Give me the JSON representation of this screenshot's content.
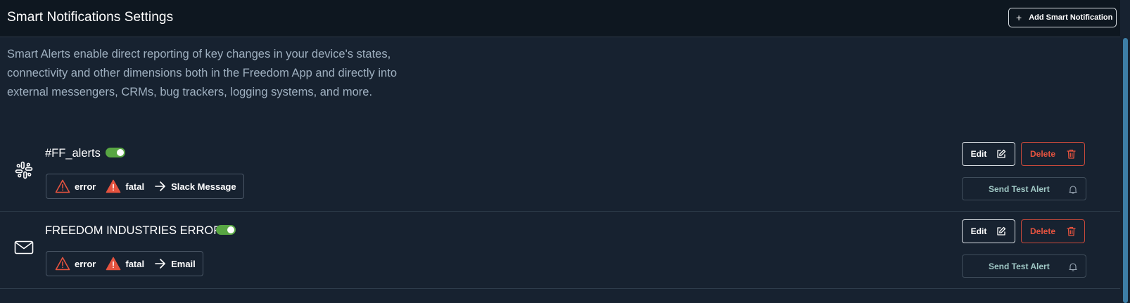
{
  "header": {
    "title": "Smart Notifications Settings",
    "add_button_label": "Add Smart Notification",
    "add_button_icon": "+"
  },
  "intro": "Smart Alerts enable direct reporting of key changes in your device's states, connectivity and other dimensions both in the Freedom App and directly into external messengers, CRMs, bug trackers, logging systems, and more.",
  "alerts": [
    {
      "name": "#FF_alerts",
      "enabled": true,
      "channel_icon": "slack-icon",
      "levels": [
        "error",
        "fatal"
      ],
      "destination": "Slack Message",
      "edit_label": "Edit",
      "delete_label": "Delete",
      "test_label": "Send Test Alert"
    },
    {
      "name": "FREEDOM INDUSTRIES ERROR",
      "enabled": true,
      "channel_icon": "mail-icon",
      "levels": [
        "error",
        "fatal"
      ],
      "destination": "Email",
      "edit_label": "Edit",
      "delete_label": "Delete",
      "test_label": "Send Test Alert"
    }
  ],
  "colors": {
    "background": "#172230",
    "header_background": "#0e1720",
    "toggle_on": "#58a643",
    "danger": "#e5533f",
    "accent_text": "#9fc7c4",
    "scrollbar": "#3d7ea6"
  }
}
